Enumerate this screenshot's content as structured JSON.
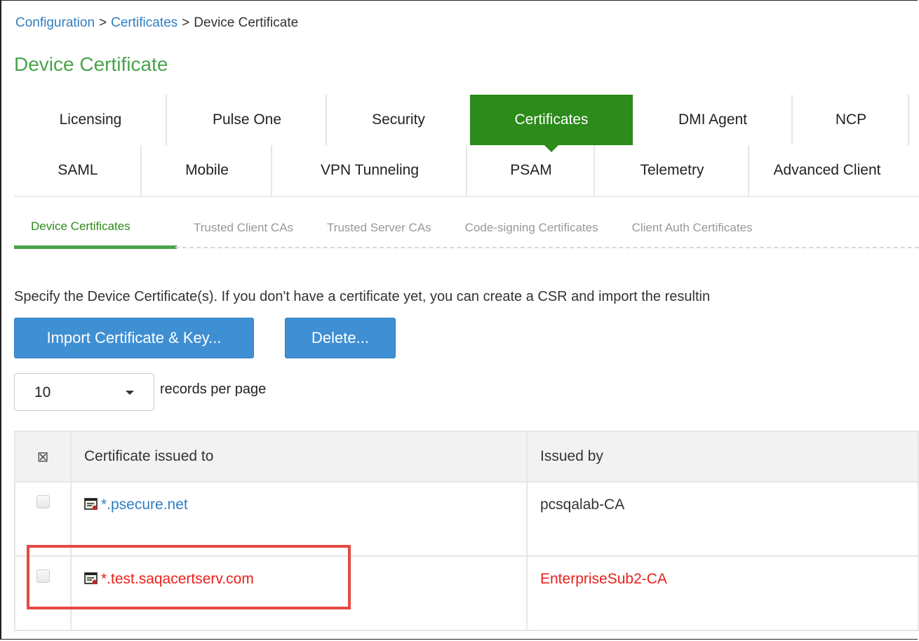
{
  "breadcrumb": {
    "items": [
      "Configuration",
      "Certificates",
      "Device Certificate"
    ],
    "separator": ">"
  },
  "page_title": "Device Certificate",
  "tabs": {
    "row1": [
      "Licensing",
      "Pulse One",
      "Security",
      "Certificates",
      "DMI Agent",
      "NCP"
    ],
    "row2": [
      "SAML",
      "Mobile",
      "VPN Tunneling",
      "PSAM",
      "Telemetry",
      "Advanced Client"
    ],
    "active": "Certificates"
  },
  "subtabs": {
    "items": [
      "Device Certificates",
      "Trusted Client CAs",
      "Trusted Server CAs",
      "Code-signing Certificates",
      "Client Auth Certificates"
    ],
    "active": "Device Certificates"
  },
  "description": "Specify the Device Certificate(s). If you don't have a certificate yet, you can create a CSR and import the resultin",
  "buttons": {
    "import": "Import Certificate & Key...",
    "delete": "Delete..."
  },
  "records_per_page": {
    "value": "10",
    "label": "records per page"
  },
  "table": {
    "header_checkbox_glyph": "⊠",
    "columns": [
      "Certificate issued to",
      "Issued by"
    ],
    "rows": [
      {
        "issued_to": "*.psecure.net",
        "issued_by": "pcsqalab-CA",
        "color": "#2f7ec1",
        "issued_by_color": "#333333",
        "checked": false
      },
      {
        "issued_to": "*.test.saqacertserv.com",
        "issued_by": "EnterpriseSub2-CA",
        "color": "#e8211b",
        "issued_by_color": "#e8211b",
        "checked": false
      }
    ]
  },
  "colors": {
    "accent_green": "#2c8b1a",
    "title_green": "#4aa34b",
    "button_blue": "#3f8fd3",
    "highlight_red": "#e44a42"
  },
  "icons": {
    "certificate": "certificate-icon",
    "dropdown": "caret-down-icon"
  }
}
